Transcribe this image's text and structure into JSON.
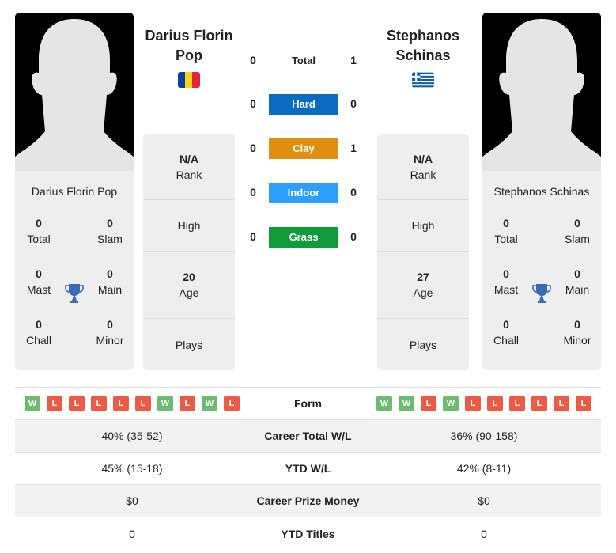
{
  "colors": {
    "hard": "#0a6bc3",
    "clay": "#e08e0b",
    "indoor": "#2c9eff",
    "grass": "#109b3a",
    "win": "#6dbb6f",
    "loss": "#ec5b45",
    "trophy": "#3a6ab8"
  },
  "player1": {
    "name_title": "Darius Florin Pop",
    "card_name": "Darius Florin Pop",
    "flag": "romania-flag",
    "titles": {
      "total": {
        "value": "0",
        "label": "Total"
      },
      "slam": {
        "value": "0",
        "label": "Slam"
      },
      "mast": {
        "value": "0",
        "label": "Mast"
      },
      "main": {
        "value": "0",
        "label": "Main"
      },
      "chall": {
        "value": "0",
        "label": "Chall"
      },
      "minor": {
        "value": "0",
        "label": "Minor"
      }
    },
    "info": {
      "rank_value": "N/A",
      "rank_label": "Rank",
      "high_label": "High",
      "age_value": "20",
      "age_label": "Age",
      "plays_label": "Plays"
    },
    "form": [
      "W",
      "L",
      "L",
      "L",
      "L",
      "L",
      "W",
      "L",
      "W",
      "L"
    ]
  },
  "player2": {
    "name_title": "Stephanos Schinas",
    "card_name": "Stephanos Schinas",
    "flag": "greece-flag",
    "titles": {
      "total": {
        "value": "0",
        "label": "Total"
      },
      "slam": {
        "value": "0",
        "label": "Slam"
      },
      "mast": {
        "value": "0",
        "label": "Mast"
      },
      "main": {
        "value": "0",
        "label": "Main"
      },
      "chall": {
        "value": "0",
        "label": "Chall"
      },
      "minor": {
        "value": "0",
        "label": "Minor"
      }
    },
    "info": {
      "rank_value": "N/A",
      "rank_label": "Rank",
      "high_label": "High",
      "age_value": "27",
      "age_label": "Age",
      "plays_label": "Plays"
    },
    "form": [
      "W",
      "W",
      "L",
      "W",
      "L",
      "L",
      "L",
      "L",
      "L",
      "L"
    ]
  },
  "h2h": [
    {
      "label": "Total",
      "left": "0",
      "right": "1",
      "type": "total"
    },
    {
      "label": "Hard",
      "left": "0",
      "right": "0",
      "type": "hard"
    },
    {
      "label": "Clay",
      "left": "0",
      "right": "1",
      "type": "clay"
    },
    {
      "label": "Indoor",
      "left": "0",
      "right": "0",
      "type": "indoor"
    },
    {
      "label": "Grass",
      "left": "0",
      "right": "0",
      "type": "grass"
    }
  ],
  "stats": {
    "form_label": "Form",
    "rows": [
      {
        "label": "Career Total W/L",
        "left": "40% (35-52)",
        "right": "36% (90-158)"
      },
      {
        "label": "YTD W/L",
        "left": "45% (15-18)",
        "right": "42% (8-11)"
      },
      {
        "label": "Career Prize Money",
        "left": "$0",
        "right": "$0"
      },
      {
        "label": "YTD Titles",
        "left": "0",
        "right": "0"
      }
    ]
  }
}
